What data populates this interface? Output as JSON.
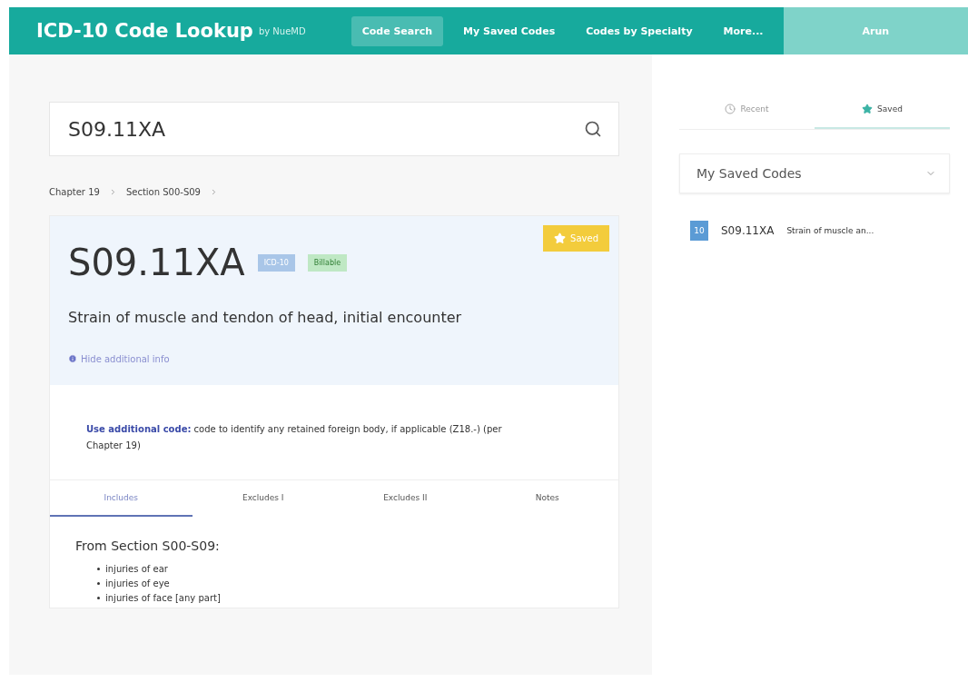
{
  "nav": {
    "title": "ICD-10 Code Lookup",
    "byline": "by NueMD",
    "links": [
      {
        "label": "Code Search",
        "selected": true
      },
      {
        "label": "My Saved Codes",
        "selected": false
      },
      {
        "label": "Codes by Specialty",
        "selected": false
      },
      {
        "label": "More...",
        "selected": false
      }
    ],
    "user": "Arun"
  },
  "search": {
    "value": "S09.11XA"
  },
  "breadcrumbs": [
    "Chapter 19",
    "Section S00-S09"
  ],
  "code": {
    "code": "S09.11XA",
    "badges": [
      {
        "label": "ICD-10",
        "color": "#a9c6e8"
      },
      {
        "label": "Billable",
        "color": "#bfe8c4"
      }
    ],
    "saved": true,
    "save_label": "Saved",
    "description": "Strain of muscle and tendon of head, initial encounter",
    "info_toggle": "Hide additional info",
    "note": "**Use additional code:** code to identify any retained foreign body, if applicable (Z18.-) (per Chapter 19)"
  },
  "tabs": [
    {
      "label": "Includes",
      "selected": true
    },
    {
      "label": "Excludes I",
      "selected": false
    },
    {
      "label": "Excludes II",
      "selected": false
    },
    {
      "label": "Notes",
      "selected": false
    }
  ],
  "includes": {
    "heading": "From Section S00-S09:",
    "items": [
      "injuries of ear",
      "injuries of eye",
      "injuries of face [any part]"
    ]
  },
  "sidebar": {
    "tabs": [
      {
        "label": "Recent",
        "kind": "clock",
        "selected": false
      },
      {
        "label": "Saved",
        "kind": "star",
        "selected": true
      }
    ],
    "dropdown": "My Saved Codes",
    "items": [
      {
        "badge": "10",
        "code": "S09.11XA",
        "description": "Strain of muscle an..."
      }
    ]
  }
}
